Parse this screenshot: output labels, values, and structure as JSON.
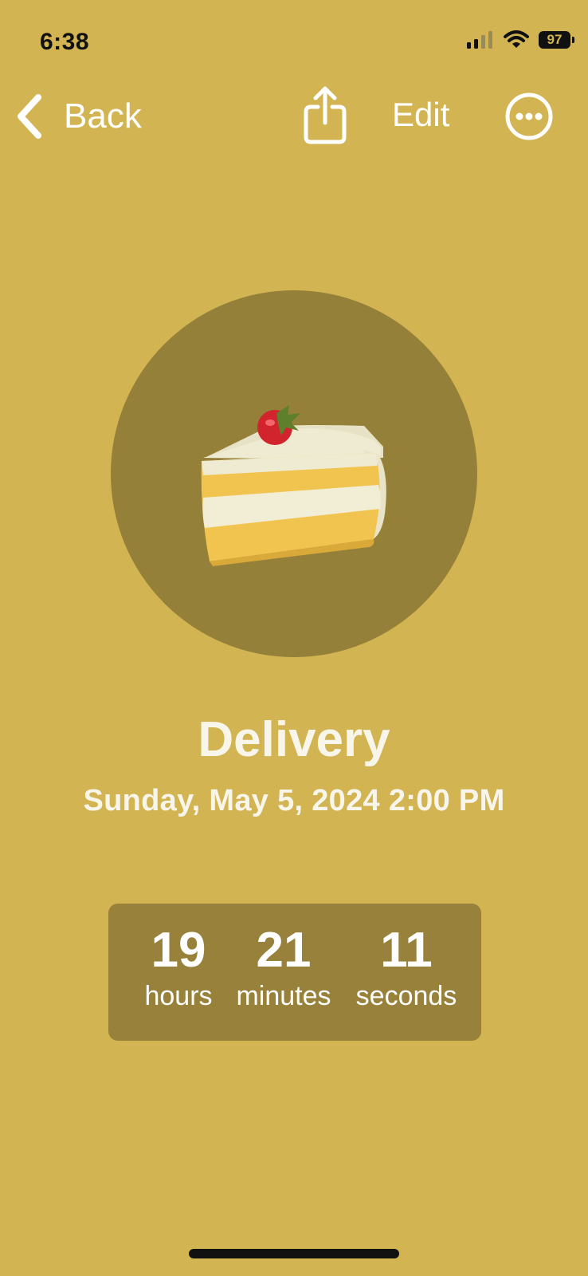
{
  "status_bar": {
    "time": "6:38",
    "battery": "97"
  },
  "nav": {
    "back_label": "Back",
    "edit_label": "Edit"
  },
  "event": {
    "icon": "cake-slice-icon",
    "title": "Delivery",
    "date": "Sunday, May 5, 2024 2:00 PM"
  },
  "countdown": {
    "hours": {
      "value": "19",
      "label": "hours"
    },
    "minutes": {
      "value": "21",
      "label": "minutes"
    },
    "seconds": {
      "value": "11",
      "label": "seconds"
    }
  },
  "colors": {
    "background": "#D2B453",
    "circle": "#95803A",
    "countdown_box": "#98813A",
    "text": "#FFFFFF"
  }
}
